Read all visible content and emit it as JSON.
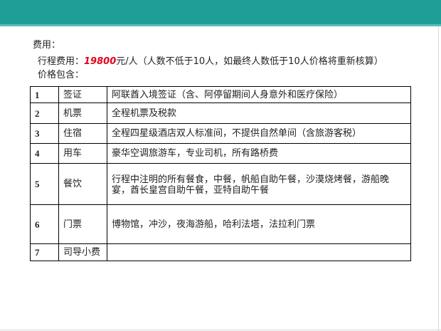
{
  "fee_heading": "费用：",
  "fee_line": {
    "prefix": "行程费用：",
    "amount": "19800",
    "suffix": "元/人（人数不低于10人，如最终人数低于10人价格将重新核算）"
  },
  "includes_heading": "价格包含：",
  "rows": [
    {
      "num": "1",
      "item": "签证",
      "detail": "阿联酋入境签证（含、阿停留期间人身意外和医疗保险）"
    },
    {
      "num": "2",
      "item": "机票",
      "detail": "全程机票及税款"
    },
    {
      "num": "3",
      "item": "住宿",
      "detail": "全程四星级酒店双人标准间，不提供自然单间（含旅游客税）"
    },
    {
      "num": "4",
      "item": "用车",
      "detail": "豪华空调旅游车，专业司机，所有路桥费"
    },
    {
      "num": "5",
      "item": "餐饮",
      "detail": "行程中注明的所有餐食，中餐，帆船自助午餐，沙漠烧烤餐，游船晚宴，酋长皇宫自助午餐，亚特自助午餐"
    },
    {
      "num": "6",
      "item": "门票",
      "detail": "博物馆，冲沙，夜海游船，哈利法塔，法拉利门票"
    },
    {
      "num": "7",
      "item": "司导小费",
      "detail": ""
    }
  ],
  "colors": {
    "header_band": "#1f9e98",
    "price_highlight": "#e3001b"
  }
}
